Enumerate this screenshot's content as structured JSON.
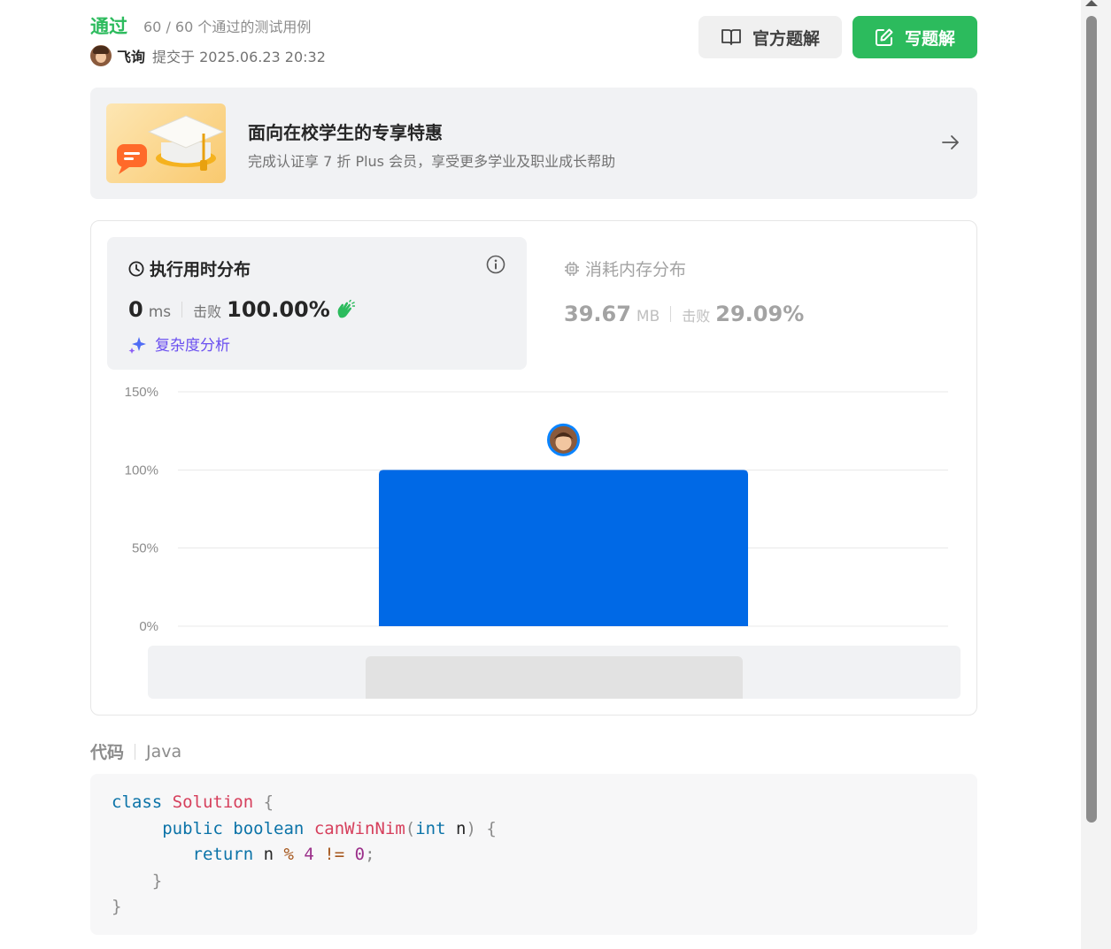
{
  "header": {
    "status": "通过",
    "cases": "60 / 60 个通过的测试用例",
    "user_name": "飞询",
    "submitted_at": "提交于 2025.06.23 20:32",
    "official_solution": "官方题解",
    "write_solution": "写题解"
  },
  "promo": {
    "title": "面向在校学生的专享特惠",
    "subtitle": "完成认证享 7 折 Plus 会员，享受更多学业及职业成长帮助"
  },
  "runtime": {
    "title": "执行用时分布",
    "value": "0",
    "unit": "ms",
    "beat_label": "击败",
    "beat_pct": "100.00%",
    "analysis": "复杂度分析"
  },
  "memory": {
    "title": "消耗内存分布",
    "value": "39.67",
    "unit": "MB",
    "beat_label": "击败",
    "beat_pct": "29.09%"
  },
  "chart_data": {
    "type": "bar",
    "yticks": [
      "150%",
      "100%",
      "50%",
      "0%"
    ],
    "ylim": [
      0,
      150
    ],
    "values": [
      100
    ],
    "grid": true
  },
  "code": {
    "label": "代码",
    "language": "Java"
  },
  "colors": {
    "accent_green": "#2cbb5d",
    "bar_blue": "#0069e6"
  }
}
